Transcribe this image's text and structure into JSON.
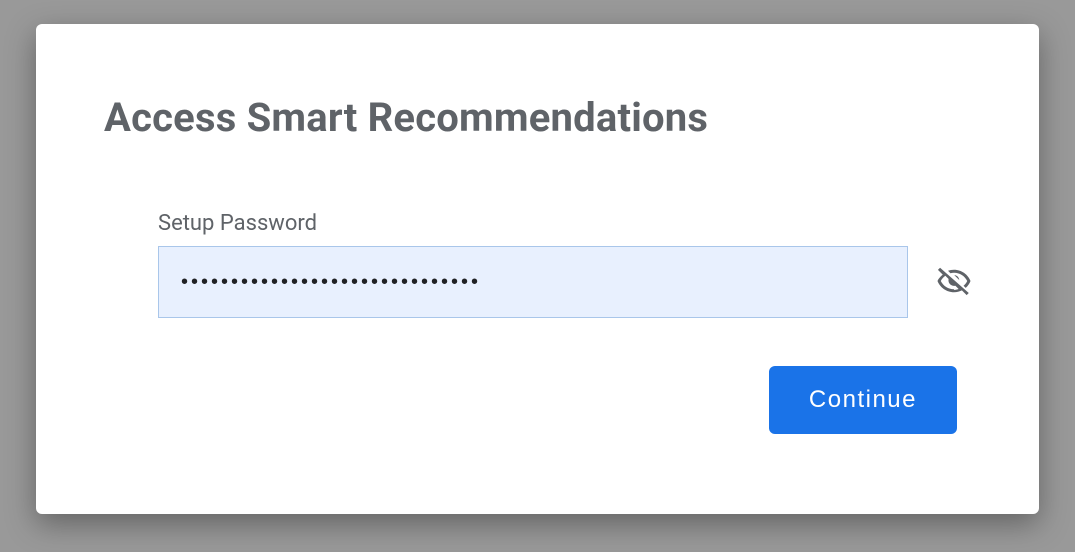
{
  "modal": {
    "title": "Access Smart Recommendations",
    "password_field": {
      "label": "Setup Password",
      "value": "••••••••••••••••••••••••••••••",
      "visibility_icon": "visibility-off"
    },
    "continue_label": "Continue"
  },
  "colors": {
    "accent": "#1a73e8",
    "input_bg": "#e8f0fe",
    "text_muted": "#5f6368"
  }
}
